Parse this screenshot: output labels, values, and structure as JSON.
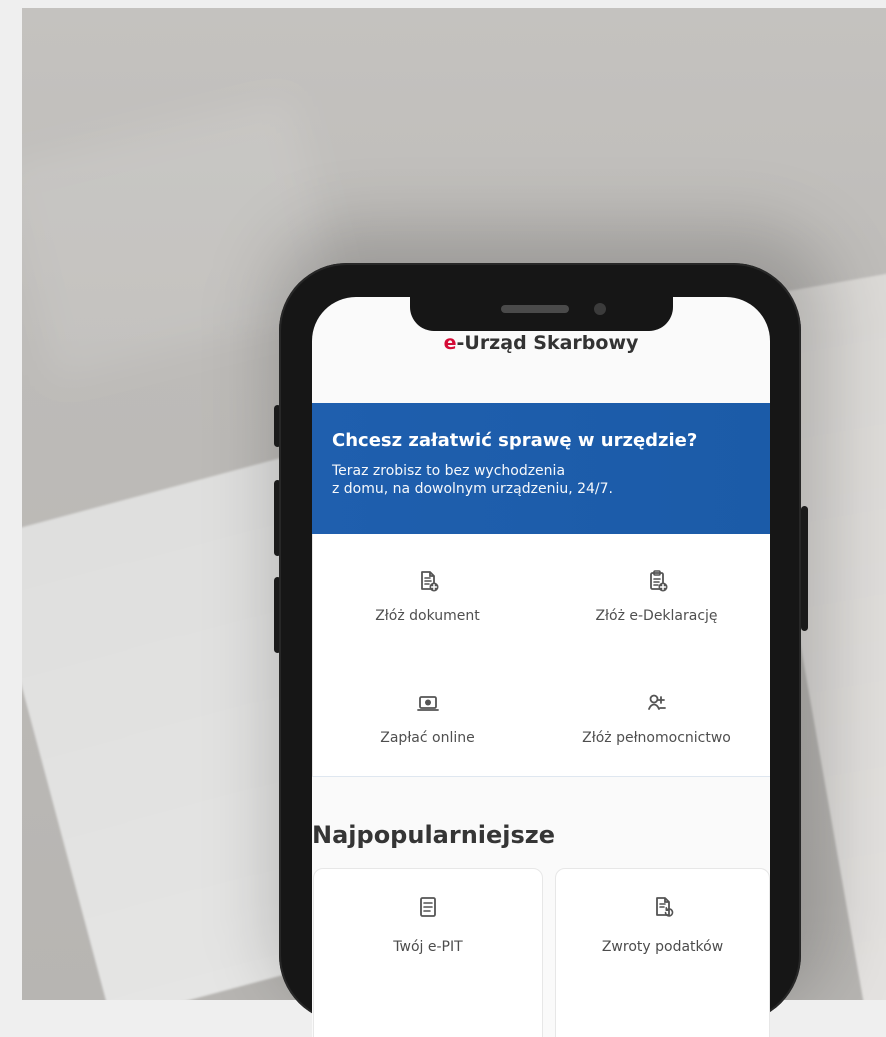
{
  "app": {
    "brand_prefix": "e",
    "brand_rest": "-Urząd Skarbowy"
  },
  "hero": {
    "title": "Chcesz załatwić sprawę w urzędzie?",
    "subtitle_line1": "Teraz zrobisz to bez wychodzenia",
    "subtitle_line2": "z domu, na dowolnym urządzeniu, 24/7."
  },
  "actions": [
    {
      "label": "Złóż dokument",
      "icon": "document-add-icon"
    },
    {
      "label": "Złóż e-Deklarację",
      "icon": "clipboard-add-icon"
    },
    {
      "label": "Zapłać online",
      "icon": "payment-icon"
    },
    {
      "label": "Złóż pełnomocnictwo",
      "icon": "user-add-icon"
    }
  ],
  "popular": {
    "title": "Najpopularniejsze",
    "items": [
      {
        "label": "Twój e-PIT",
        "icon": "document-list-icon"
      },
      {
        "label": "Zwroty podatków",
        "icon": "refund-icon"
      }
    ]
  },
  "colors": {
    "brand_red": "#d50b36",
    "hero_blue": "#1f5fae",
    "text_dark": "#333333"
  }
}
